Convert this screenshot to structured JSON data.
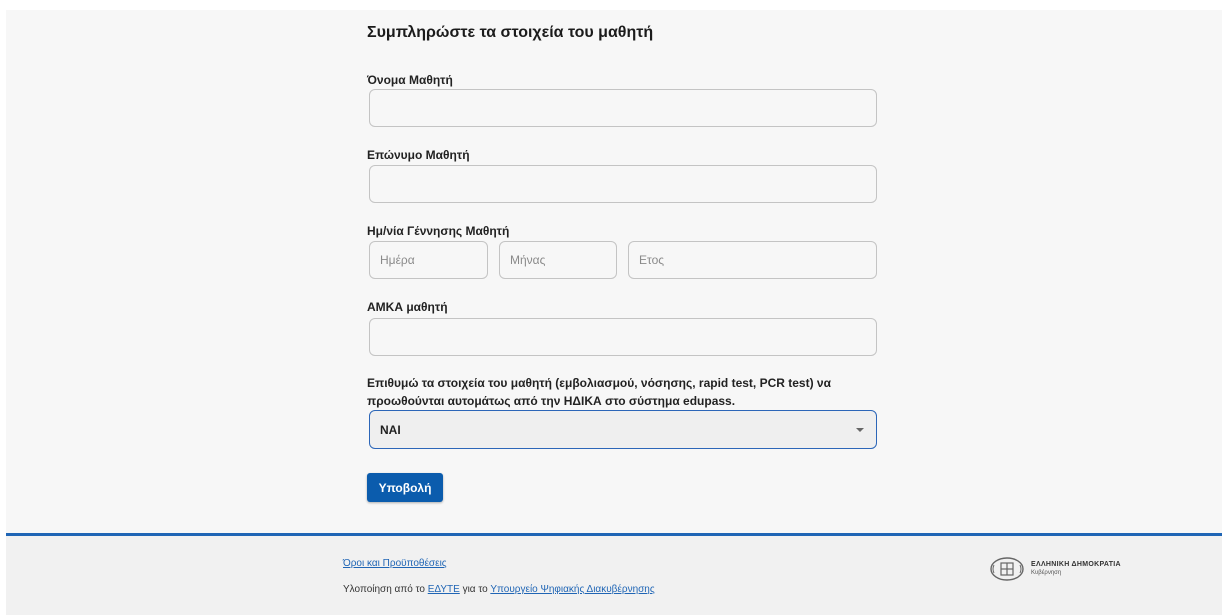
{
  "form": {
    "title": "Συμπληρώστε τα στοιχεία του μαθητή",
    "first_name": {
      "label": "Όνομα Μαθητή",
      "value": "",
      "placeholder": ""
    },
    "last_name": {
      "label": "Επώνυμο Μαθητή",
      "value": "",
      "placeholder": ""
    },
    "birth_date": {
      "label": "Ημ/νία Γέννησης Μαθητή",
      "day_placeholder": "Ημέρα",
      "month_placeholder": "Μήνας",
      "year_placeholder": "Ετος"
    },
    "amka": {
      "label": "ΑΜΚΑ μαθητή",
      "value": "",
      "placeholder": ""
    },
    "consent": {
      "label": "Επιθυμώ τα στοιχεία του μαθητή (εμβολιασμού, νόσησης, rapid test, PCR test) να προωθούνται αυτομάτως από την ΗΔΙΚΑ στο σύστημα edupass.",
      "selected": "ΝΑΙ"
    },
    "submit_label": "Υποβολή"
  },
  "footer": {
    "terms_link": "Όροι και Προϋποθέσεις",
    "credit_prefix": "Υλοποίηση από το",
    "credit_org": "ΕΔΥΤΕ",
    "credit_middle": "για το",
    "credit_ministry": "Υπουργείο Ψηφιακής Διακυβέρνησης",
    "gov_name": "ΕΛΛΗΝΙΚΗ ΔΗΜΟΚΡΑΤΙΑ",
    "gov_sub": "Κυβέρνηση"
  },
  "colors": {
    "accent": "#0b5cad",
    "footer_border": "#1f65b5",
    "panel_bg": "#f7f7f7"
  }
}
